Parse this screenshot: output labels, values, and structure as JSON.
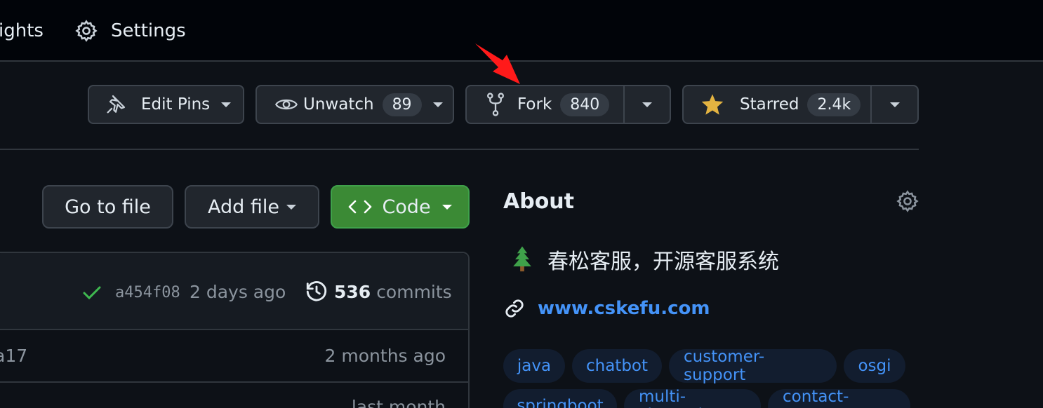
{
  "top_nav": {
    "insights_label": "ights",
    "settings_label": "Settings"
  },
  "repo_actions": {
    "edit_pins_label": "Edit Pins",
    "unwatch_label": "Unwatch",
    "watch_count": "89",
    "fork_label": "Fork",
    "fork_count": "840",
    "starred_label": "Starred",
    "star_count": "2.4k"
  },
  "file_actions": {
    "go_to_file_label": "Go to file",
    "add_file_label": "Add file",
    "code_label": "Code"
  },
  "commit_summary": {
    "hash": "a454f08",
    "time": "2 days ago",
    "commits_count": "536",
    "commits_label": "commits"
  },
  "file_rows": [
    {
      "name_fragment": "a17",
      "time": "2 months ago"
    },
    {
      "time": "last month"
    }
  ],
  "about": {
    "title": "About",
    "description": "春松客服，开源客服系统",
    "website": "www.cskefu.com",
    "topics": [
      "java",
      "chatbot",
      "customer-support",
      "osgi",
      "springboot",
      "multi-channel",
      "contact-center"
    ]
  },
  "colors": {
    "accent_green": "#3b8a35",
    "link_blue": "#4493f8",
    "star_yellow": "#e3b341",
    "annotation_red": "#ff1a1a"
  }
}
